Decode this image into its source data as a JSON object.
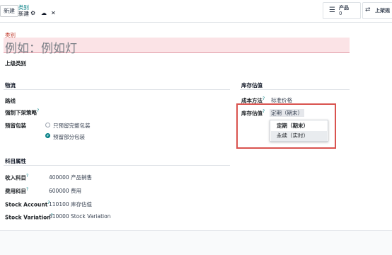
{
  "control_panel": {
    "new_button": "新建",
    "breadcrumb_parent": "类别",
    "breadcrumb_current": "新建",
    "icons": [
      "gear-icon",
      "cloud-upload-icon",
      "close-icon"
    ],
    "smart_button_products": {
      "label": "产品",
      "count": "0",
      "icon": "list-icon"
    },
    "smart_button_putaway": {
      "label": "上架规",
      "icon": "shuffle-icon"
    }
  },
  "form": {
    "name_label": "类别",
    "name_placeholder": "例如：例如灯",
    "parent_label": "上级类别",
    "logistics": {
      "title": "物流",
      "routes_label": "路线",
      "removal_strategy_label": "强制下架策略",
      "reservation_label": "预留包装",
      "reservation_options": [
        "只预留完整包装",
        "预留部分包装"
      ],
      "reservation_selected": 1
    },
    "accounts": {
      "title": "科目属性",
      "rows": [
        {
          "label": "收入科目",
          "value": "400000 产品销售",
          "help": true
        },
        {
          "label": "费用科目",
          "value": "600000 费用",
          "help": true
        },
        {
          "label": "Stock Account",
          "value": "110100 库存估值",
          "help": true
        },
        {
          "label": "Stock Variation",
          "value": "610000 Stock Variation",
          "help": true
        }
      ]
    },
    "valuation": {
      "title": "库存估值",
      "costing_label": "成本方法",
      "costing_value": "标准价格",
      "valuation_label": "库存估值",
      "valuation_value": "定期（期末）",
      "dropdown_options": [
        "定期（期末）",
        "永续（实时）"
      ],
      "dropdown_hovered": 1
    }
  },
  "colors": {
    "accent": "#017e84",
    "required_bg": "#fbe3e6",
    "highlight": "#d9534f"
  }
}
